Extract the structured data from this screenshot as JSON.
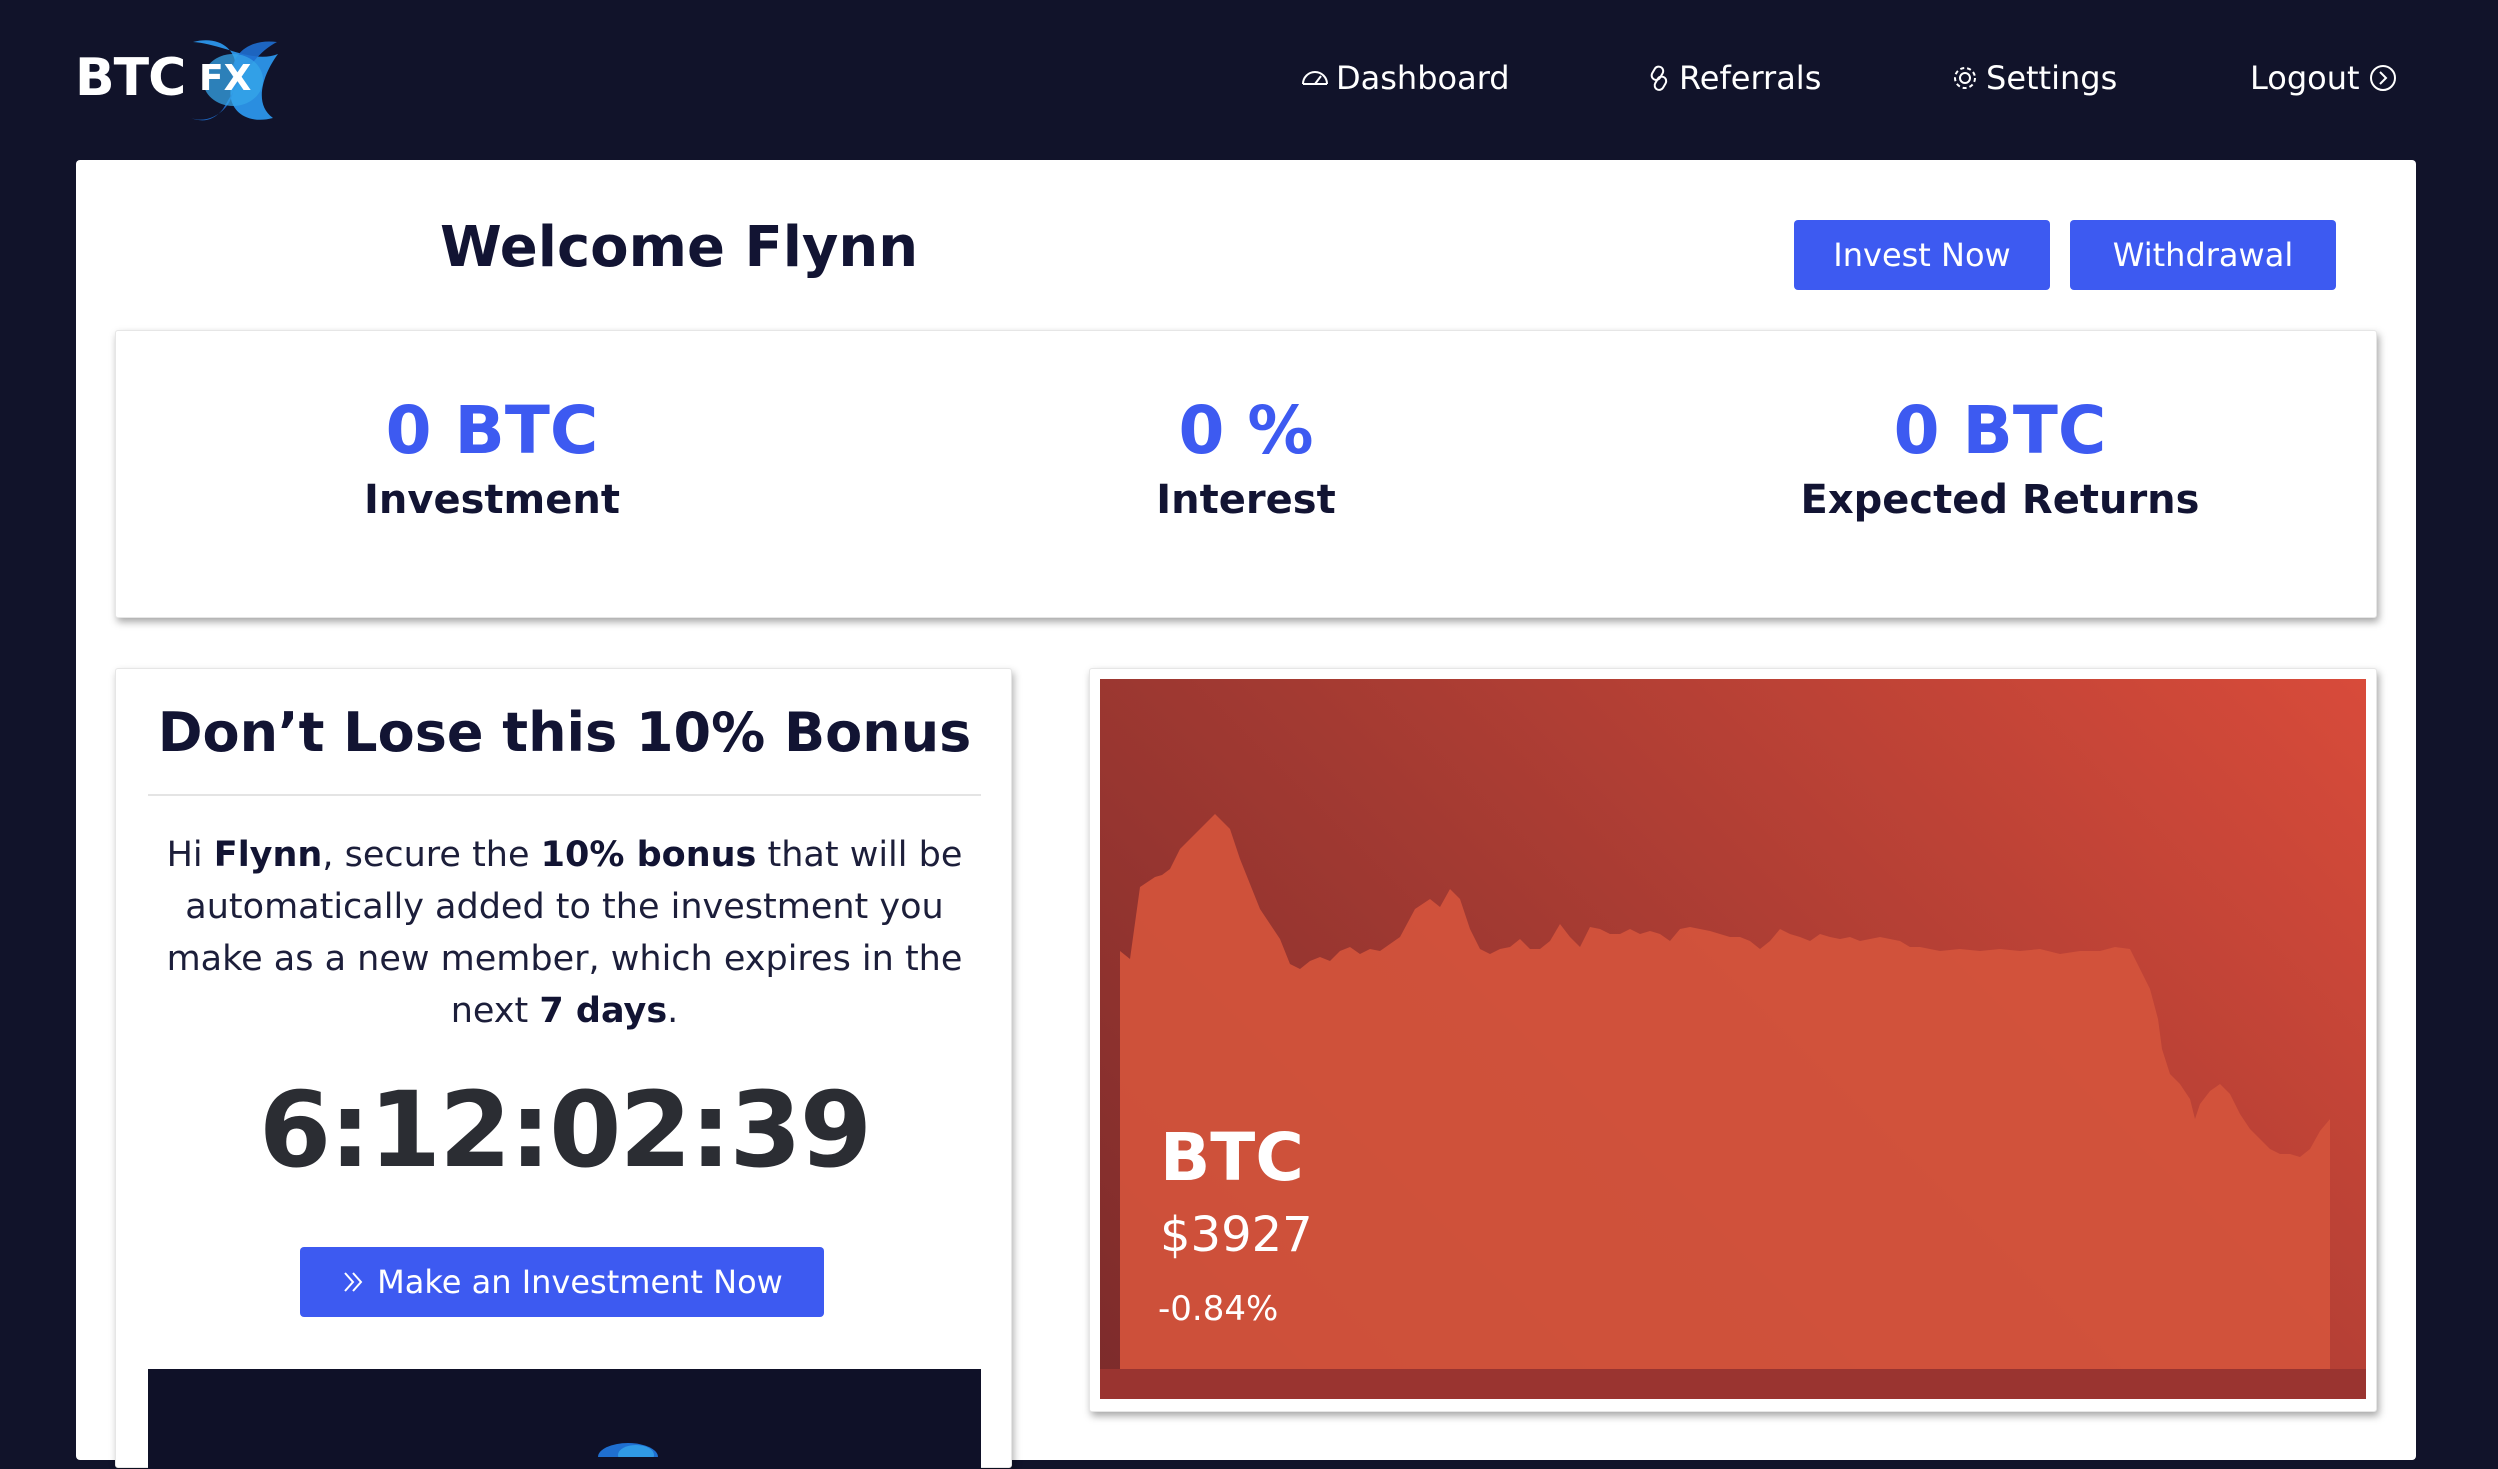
{
  "header": {
    "logo": {
      "primary": "BTC",
      "secondary": "FX"
    },
    "nav": [
      {
        "label": "Dashboard",
        "icon": "dashboard-icon"
      },
      {
        "label": "Referrals",
        "icon": "link-icon"
      },
      {
        "label": "Settings",
        "icon": "gear-icon"
      },
      {
        "label": "Logout",
        "icon": "logout-arrow-icon"
      }
    ]
  },
  "welcome": {
    "title": "Welcome Flynn",
    "invest_label": "Invest Now",
    "withdraw_label": "Withdrawal"
  },
  "stats": [
    {
      "value": "0 BTC",
      "label": "Investment"
    },
    {
      "value": "0 %",
      "label": "Interest"
    },
    {
      "value": "0 BTC",
      "label": "Expected Returns"
    }
  ],
  "bonus": {
    "heading": "Don’t Lose this 10% Bonus",
    "text_parts": {
      "hi": "Hi ",
      "name": "Flynn",
      "t1": ", secure the ",
      "bonus": "10% bonus",
      "t2": " that will be automatically added to the investment you make as a new member, which expires in the next ",
      "days": "7 days",
      "t3": "."
    },
    "countdown": "6:12:02:39",
    "cta_label": "Make an Investment Now"
  },
  "btc": {
    "symbol": "BTC",
    "price": "$3927",
    "change": "-0.84%",
    "colors": {
      "gradient_start": "#7c2b2b",
      "gradient_end": "#d84b3a",
      "area": "#d4543c"
    }
  },
  "colors": {
    "background": "#11132a",
    "accent": "#3d5af1",
    "heading": "#121433"
  }
}
